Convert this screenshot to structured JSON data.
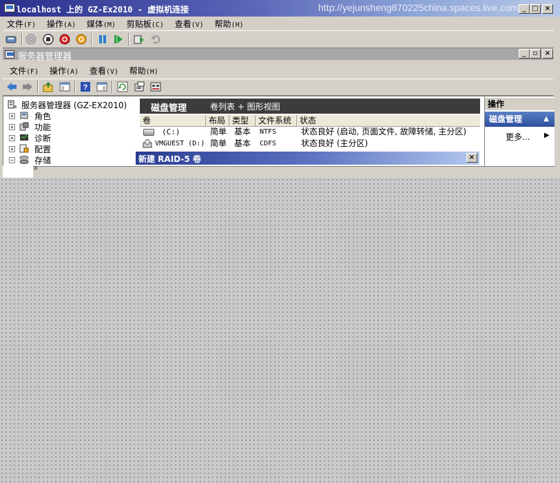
{
  "vm_window": {
    "title": "localhost 上的 GZ-Ex2010 - 虚拟机连接",
    "watermark": "http://yejunsheng870225china.spaces.live.com",
    "menu": [
      {
        "label": "文件",
        "acc": "(F)"
      },
      {
        "label": "操作",
        "acc": "(A)"
      },
      {
        "label": "媒体",
        "acc": "(M)"
      },
      {
        "label": "剪贴板",
        "acc": "(C)"
      },
      {
        "label": "查看",
        "acc": "(V)"
      },
      {
        "label": "帮助",
        "acc": "(H)"
      }
    ],
    "controls": {
      "minimize": "_",
      "restore": "□",
      "close": "×"
    }
  },
  "server_manager": {
    "title": "服务器管理器",
    "menu": [
      {
        "label": "文件",
        "acc": "(F)"
      },
      {
        "label": "操作",
        "acc": "(A)"
      },
      {
        "label": "查看",
        "acc": "(V)"
      },
      {
        "label": "帮助",
        "acc": "(H)"
      }
    ],
    "controls": {
      "minimize": "_",
      "restore": "▫",
      "close": "×"
    }
  },
  "tree": {
    "root": "服务器管理器 (GZ-EX2010)",
    "items": [
      {
        "label": "角色",
        "expander": "+"
      },
      {
        "label": "功能",
        "expander": "+"
      },
      {
        "label": "诊断",
        "expander": "+"
      },
      {
        "label": "配置",
        "expander": "+"
      },
      {
        "label": "存储",
        "expander": "−"
      }
    ],
    "stub_text": "※"
  },
  "disk_management": {
    "title": "磁盘管理",
    "view": "卷列表 + 图形视图",
    "columns": [
      "卷",
      "布局",
      "类型",
      "文件系统",
      "状态"
    ],
    "rows": [
      {
        "volume": "(C:)",
        "layout": "简单",
        "type": "基本",
        "fs": "NTFS",
        "status": "状态良好 (启动, 页面文件, 故障转储, 主分区)"
      },
      {
        "volume": "VMGUEST (D:)",
        "layout": "简单",
        "type": "基本",
        "fs": "CDFS",
        "status": "状态良好 (主分区)"
      }
    ]
  },
  "actions": {
    "header": "操作",
    "section": "磁盘管理",
    "section_toggle": "▲",
    "more": "更多...",
    "more_arrow": "▶"
  },
  "raid_dialog": {
    "title": "新建 RAID-5 卷",
    "close": "×"
  },
  "colors": {
    "window_face": "#d4d0c8",
    "titlebar_start": "#2a2f8c",
    "actions_accent": "#2d4f9e",
    "desktop": "#c9c9c9"
  }
}
